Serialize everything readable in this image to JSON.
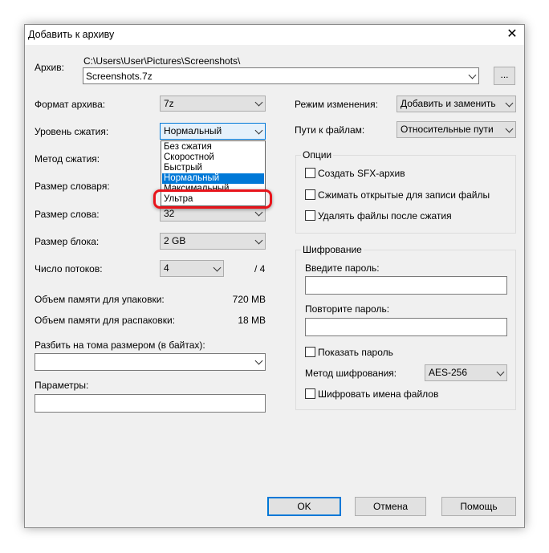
{
  "window": {
    "title": "Добавить к архиву",
    "close": "✕"
  },
  "archive": {
    "label": "Архив:",
    "path": "C:\\Users\\User\\Pictures\\Screenshots\\",
    "value": "Screenshots.7z",
    "browse": "..."
  },
  "left": {
    "format": {
      "label": "Формат архива:",
      "value": "7z"
    },
    "level": {
      "label": "Уровень сжатия:",
      "value": "Нормальный",
      "options": [
        "Без сжатия",
        "Скоростной",
        "Быстрый",
        "Нормальный",
        "Максимальный",
        "Ультра"
      ],
      "selected_index": 3
    },
    "method": {
      "label": "Метод сжатия:"
    },
    "dict": {
      "label": "Размер словаря:"
    },
    "word": {
      "label": "Размер слова:",
      "value": "32"
    },
    "block": {
      "label": "Размер блока:",
      "value": "2 GB"
    },
    "threads": {
      "label": "Число потоков:",
      "value": "4",
      "max": "/ 4"
    },
    "mem_pack": {
      "label": "Объем памяти для упаковки:",
      "value": "720 MB"
    },
    "mem_unpack": {
      "label": "Объем памяти для распаковки:",
      "value": "18 MB"
    },
    "split": {
      "label": "Разбить на тома размером (в байтах):",
      "value": ""
    },
    "params": {
      "label": "Параметры:",
      "value": ""
    }
  },
  "right": {
    "update_mode": {
      "label": "Режим изменения:",
      "value": "Добавить и заменить"
    },
    "path_mode": {
      "label": "Пути к файлам:",
      "value": "Относительные пути"
    },
    "options": {
      "title": "Опции",
      "items": [
        "Создать SFX-архив",
        "Сжимать открытые для записи файлы",
        "Удалять файлы после сжатия"
      ]
    },
    "encryption": {
      "title": "Шифрование",
      "password_label": "Введите пароль:",
      "repeat_label": "Повторите пароль:",
      "show_password": "Показать пароль",
      "method_label": "Метод шифрования:",
      "method_value": "AES-256",
      "encrypt_names": "Шифровать имена файлов"
    }
  },
  "buttons": {
    "ok": "OK",
    "cancel": "Отмена",
    "help": "Помощь"
  },
  "colors": {
    "selection": "#0078d7",
    "highlight": "#e8141b",
    "default_button_border": "#0078d7"
  }
}
